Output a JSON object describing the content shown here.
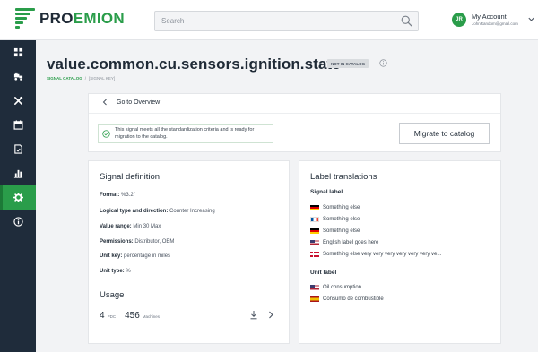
{
  "brand": {
    "logo_prefix": "PRO",
    "logo_suffix": "EMION",
    "accent": "#2a9d4a",
    "sidebar_bg": "#1f2c3b"
  },
  "search": {
    "placeholder": "Search",
    "icon": "search-icon"
  },
  "account": {
    "initials": "JR",
    "title": "My Account",
    "email": "JohnRandom@gmail.com"
  },
  "sidebar": {
    "items": [
      {
        "icon": "grid-icon",
        "active": false
      },
      {
        "icon": "vehicles-icon",
        "active": false
      },
      {
        "icon": "tools-icon",
        "active": false
      },
      {
        "icon": "calendar-icon",
        "active": false
      },
      {
        "icon": "document-check-icon",
        "active": false
      },
      {
        "icon": "bar-chart-icon",
        "active": false
      },
      {
        "icon": "settings-gear-icon",
        "active": true
      },
      {
        "icon": "info-icon",
        "active": false
      }
    ]
  },
  "page": {
    "title": "value.common.cu.sensors.ignition.state",
    "status_badge": "NOT IN CATALOG",
    "breadcrumb": {
      "link": "SIGNAL CATALOG",
      "separator": "/",
      "current": "[SIGNAL KEY]"
    }
  },
  "overview": {
    "back_label": "Go to Overview",
    "banner_text": "This signal meets all the standardization criteria and is ready for migration to the catalog.",
    "migrate_label": "Migrate to catalog"
  },
  "definition": {
    "title": "Signal definition",
    "fields": [
      {
        "label": "Format:",
        "value": "%3.2f"
      },
      {
        "label": "Logical type and direction:",
        "value": "Counter Increasing"
      },
      {
        "label": "Value range:",
        "value": "Min 30 Max"
      },
      {
        "label": "Permissions:",
        "value": "Distributor, OEM"
      },
      {
        "label": "Unit key:",
        "value": "percentage in miles"
      },
      {
        "label": "Unit type:",
        "value": "%"
      }
    ],
    "usage": {
      "title": "Usage",
      "pdc_count": "4",
      "pdc_label": "PDC",
      "machines_count": "456",
      "machines_label": "Machines"
    }
  },
  "translations": {
    "title": "Label translations",
    "signal_label_title": "Signal label",
    "signal_labels": [
      {
        "flag": "de",
        "text": "Something else"
      },
      {
        "flag": "fr",
        "text": "Something else"
      },
      {
        "flag": "de",
        "text": "Something else"
      },
      {
        "flag": "us",
        "text": "English label goes here"
      },
      {
        "flag": "dk",
        "text": "Something else very very very very very very ve..."
      }
    ],
    "unit_label_title": "Unit label",
    "unit_labels": [
      {
        "flag": "us",
        "text": "Oil consumption"
      },
      {
        "flag": "es",
        "text": "Consumo de combustible"
      }
    ]
  }
}
